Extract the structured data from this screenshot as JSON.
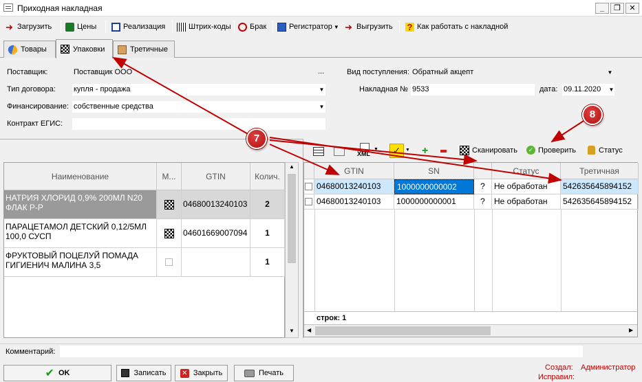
{
  "window": {
    "title": "Приходная накладная"
  },
  "toolbar": {
    "load": "Загрузить",
    "prices": "Цены",
    "realization": "Реализация",
    "barcodes": "Штрих-коды",
    "defect": "Брак",
    "registrar": "Регистратор",
    "upload": "Выгрузить",
    "help": "Как работать с накладной"
  },
  "tabs": {
    "goods": "Товары",
    "packages": "Упаковки",
    "tertiary": "Третичные"
  },
  "form": {
    "supplier_label": "Поставщик:",
    "supplier_value": "Поставщик ООО",
    "contract_type_label": "Тип договора:",
    "contract_type_value": "купля - продажа",
    "financing_label": "Финансирование:",
    "financing_value": "собственные средства",
    "egis_label": "Контракт ЕГИС:",
    "egis_value": "",
    "receipt_type_label": "Вид поступления:",
    "receipt_type_value": "Обратный акцепт",
    "invoice_label": "Накладная №",
    "invoice_value": "9533",
    "date_label": "дата:",
    "date_value": "09.11.2020",
    "ellipsis": "..."
  },
  "left_grid": {
    "columns": [
      "Наименование",
      "М...",
      "GTIN",
      "Колич."
    ],
    "rows": [
      {
        "name": "НАТРИЯ ХЛОРИД 0,9% 200МЛ N20 ФЛАК Р-Р",
        "gtin": "04680013240103",
        "qty": "2"
      },
      {
        "name": "ПАРАЦЕТАМОЛ ДЕТСКИЙ 0,12/5МЛ 100,0 СУСП",
        "gtin": "04601669007094",
        "qty": "1"
      },
      {
        "name": "ФРУКТОВЫЙ ПОЦЕЛУЙ ПОМАДА ГИГИЕНИЧ МАЛИНА 3,5",
        "gtin": "",
        "qty": "1"
      }
    ]
  },
  "right_toolbar": {
    "xml": "XML",
    "scan": "Сканировать",
    "check": "Проверить",
    "status": "Статус"
  },
  "right_grid": {
    "columns": [
      "GTIN",
      "SN",
      "Статус",
      "Третичная"
    ],
    "rows": [
      {
        "gtin": "04680013240103",
        "sn": "1000000000002",
        "q": "?",
        "status": "Не обработан",
        "tertiary": "542635645894152"
      },
      {
        "gtin": "04680013240103",
        "sn": "1000000000001",
        "q": "?",
        "status": "Не обработан",
        "tertiary": "542635645894152"
      }
    ],
    "footer": "строк: 1"
  },
  "comment": {
    "label": "Комментарий:",
    "value": ""
  },
  "buttons": {
    "ok": "OK",
    "save": "Записать",
    "close": "Закрыть",
    "print": "Печать"
  },
  "meta": {
    "created_label": "Создал:",
    "created_value": "Администратор",
    "edited_label": "Исправил:"
  },
  "callouts": {
    "c7": "7",
    "c8": "8"
  },
  "colors": {
    "accent_red": "#c00000",
    "selection_blue": "#0078d7",
    "row_selected_gray": "#9a9a9a"
  }
}
